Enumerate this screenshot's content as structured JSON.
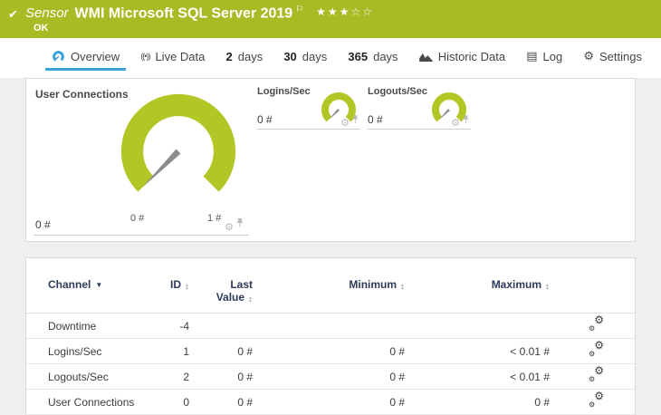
{
  "colors": {
    "green": "#a9bb24",
    "gauge_green": "#b2c725",
    "blue": "#38a3da",
    "navy": "#2e3a59",
    "page_bg": "#efefef",
    "panel_border": "#d9d9d9",
    "needle": "#8c8c8c",
    "text": "#3c3c3c",
    "icon_gray": "#b9b9b9",
    "line": "#e5e5e5",
    "tab_text": "#454545"
  },
  "icons": {
    "check": "✔",
    "flag": "⚐",
    "gear": "⚙",
    "log": "▤",
    "sort_up": "▲",
    "sort_down": "▼",
    "broadcast": "((•))"
  },
  "header": {
    "kind": "Sensor",
    "title": "WMI Microsoft SQL Server 2019",
    "status": "OK",
    "stars": "★★★☆☆"
  },
  "tabs": [
    {
      "label": "Overview"
    },
    {
      "label": "Live Data"
    },
    {
      "num": "2",
      "label": "days"
    },
    {
      "num": "30",
      "label": "days"
    },
    {
      "num": "365",
      "label": "days"
    },
    {
      "label": "Historic Data"
    },
    {
      "label": "Log"
    },
    {
      "label": "Settings"
    }
  ],
  "gauges": {
    "primary": {
      "title": "User Connections",
      "last_value": "0 #",
      "scale_min": "0 #",
      "scale_max": "1 #"
    },
    "secondary": [
      {
        "title": "Logins/Sec",
        "last_value": "0 #"
      },
      {
        "title": "Logouts/Sec",
        "last_value": "0 #"
      }
    ]
  },
  "table": {
    "headers": {
      "channel": "Channel",
      "id": "ID",
      "last_line1": "Last",
      "last_line2": "Value",
      "minimum": "Minimum",
      "maximum": "Maximum"
    },
    "rows": [
      {
        "channel": "Downtime",
        "id": "-4",
        "last": "",
        "min": "",
        "max": ""
      },
      {
        "channel": "Logins/Sec",
        "id": "1",
        "last": "0 #",
        "min": "0 #",
        "max": "< 0.01 #"
      },
      {
        "channel": "Logouts/Sec",
        "id": "2",
        "last": "0 #",
        "min": "0 #",
        "max": "< 0.01 #"
      },
      {
        "channel": "User Connections",
        "id": "0",
        "last": "0 #",
        "min": "0 #",
        "max": "0 #"
      }
    ]
  }
}
